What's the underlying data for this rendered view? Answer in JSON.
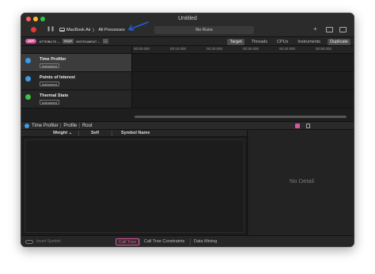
{
  "window": {
    "title": "Untitled"
  },
  "toolbar": {
    "target_device": "MacBook Air",
    "target_process": "All Processes",
    "breadcrumb_sep": "〉",
    "runs_label": "No Runs",
    "plus_label": "+"
  },
  "filter_bar": {
    "pill": "ANY",
    "tokens": [
      "ATTRIBUTE ⌄",
      "target",
      "INSTRUMENT ⌄",
      "⌄"
    ],
    "tabs": [
      "Target",
      "Threads",
      "CPUs",
      "Instruments"
    ],
    "active_tab": "Target",
    "duplicate_label": "Duplicate"
  },
  "ruler": {
    "ticks": [
      "00:00.000",
      "00:10.000",
      "00:20.000",
      "00:30.000",
      "00:40.000",
      "00:50.000"
    ]
  },
  "instruments": [
    {
      "name": "Time Profiler",
      "badge": "Instrument",
      "color": "#3b9be6",
      "selected": true
    },
    {
      "name": "Points of Interest",
      "badge": "Instrument",
      "color": "#3b9be6",
      "selected": false
    },
    {
      "name": "Thermal State",
      "badge": "Instrument",
      "color": "#3fbf4a",
      "selected": false
    }
  ],
  "jump_bar": {
    "items": [
      "Time Profiler",
      "Profile",
      "Root"
    ]
  },
  "table": {
    "columns": [
      "Weight ⌄",
      "Self",
      "Symbol Name"
    ]
  },
  "detail": {
    "empty_text": "No Detail"
  },
  "bottom_bar": {
    "invert_label": "Invert Symbol",
    "tabs": [
      "Call Tree",
      "Call Tree Constraints",
      "Data Mining"
    ],
    "active_tab": "Call Tree"
  },
  "colors": {
    "accent_pink": "#d8569d",
    "record_red": "#e03e3e",
    "annotation_blue": "#1f5fd6"
  }
}
